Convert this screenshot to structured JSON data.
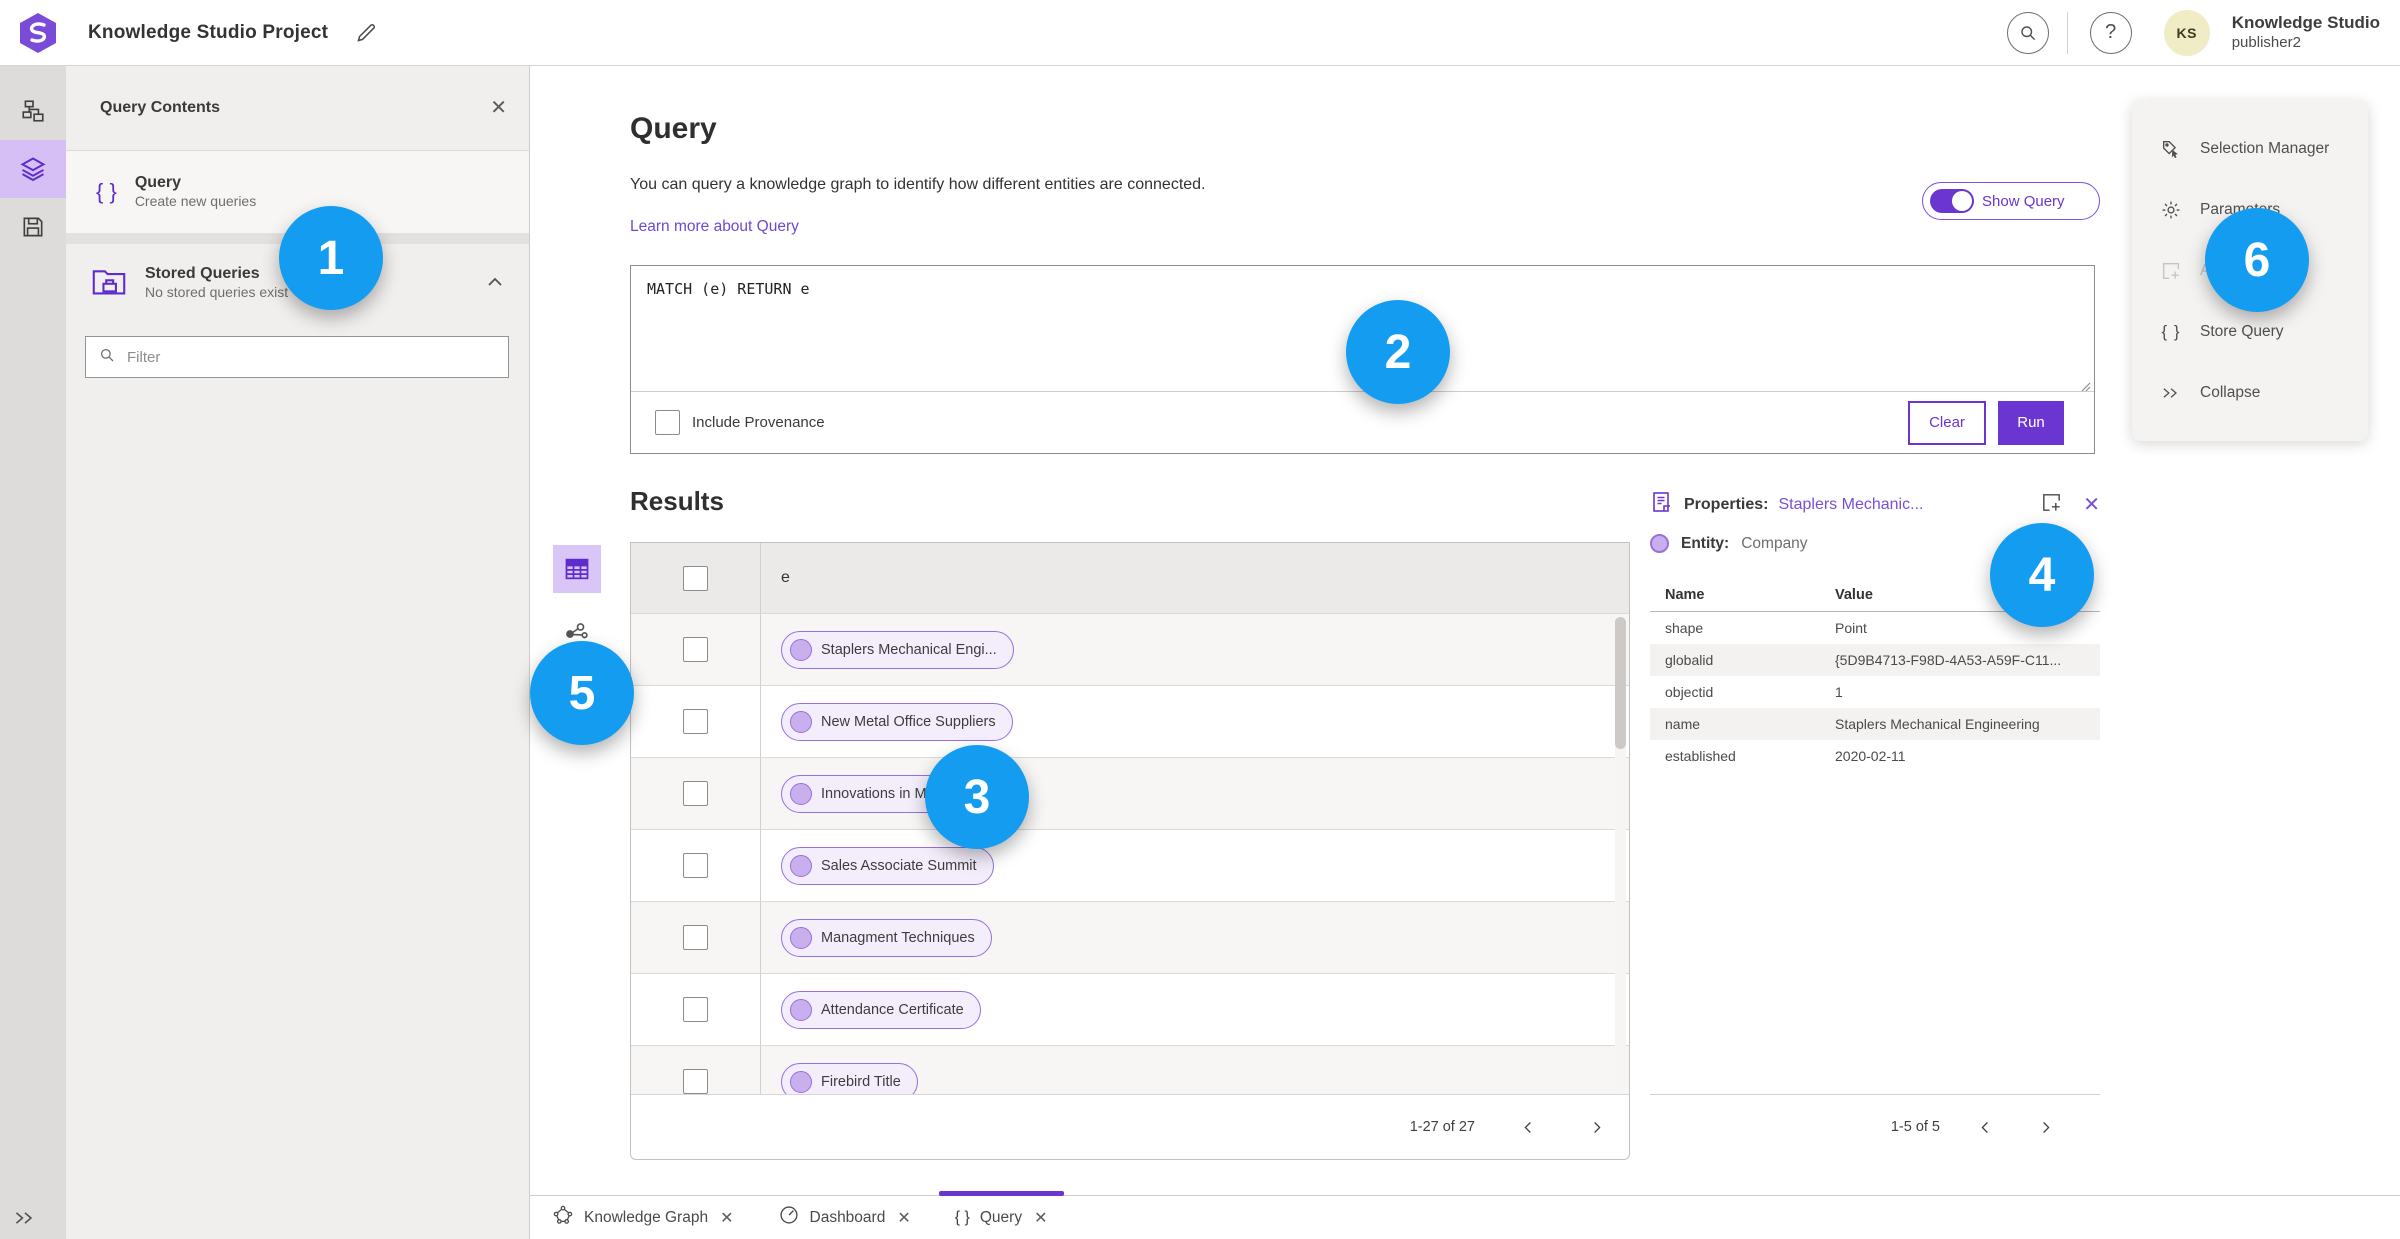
{
  "header": {
    "title": "Knowledge Studio Project",
    "user_name": "Knowledge Studio",
    "user_role": "publisher2",
    "avatar_initials": "KS",
    "help_glyph": "?"
  },
  "left_panel": {
    "title": "Query Contents",
    "close_glyph": "✕",
    "query_item": {
      "label": "Query",
      "sublabel": "Create new queries",
      "icon_glyph": "{ }"
    },
    "stored_item": {
      "label": "Stored Queries",
      "sublabel": "No stored queries exist"
    },
    "filter_placeholder": "Filter"
  },
  "query_section": {
    "heading": "Query",
    "description": "You can query a knowledge graph to identify how different entities are connected.",
    "link": "Learn more about Query",
    "show_query_label": "Show Query",
    "query_text": "MATCH (e) RETURN e",
    "provenance_label": "Include Provenance",
    "clear_label": "Clear",
    "run_label": "Run"
  },
  "results": {
    "heading": "Results",
    "column": "e",
    "rows": [
      "Staplers Mechanical Engi...",
      "New Metal Office Suppliers",
      "Innovations in Mechanical...",
      "Sales Associate Summit",
      "Managment Techniques",
      "Attendance Certificate",
      "Firebird Title"
    ],
    "pagination": "1-27 of 27"
  },
  "properties": {
    "label": "Properties:",
    "entity_link": "Staplers Mechanic...",
    "close_glyph": "✕",
    "entity_label": "Entity:",
    "entity_type": "Company",
    "columns": [
      "Name",
      "Value"
    ],
    "rows": [
      [
        "shape",
        "Point"
      ],
      [
        "globalid",
        "{5D9B4713-F98D-4A53-A59F-C11..."
      ],
      [
        "objectid",
        "1"
      ],
      [
        "name",
        "Staplers Mechanical Engineering"
      ],
      [
        "established",
        "2020-02-11"
      ]
    ],
    "pagination": "1-5 of 5"
  },
  "right_menu": {
    "items": [
      "Selection Manager",
      "Parameters",
      "Add",
      "Store Query",
      "Collapse"
    ],
    "store_query_glyph": "{ }"
  },
  "tabs": [
    {
      "label": "Knowledge Graph",
      "close_glyph": "✕"
    },
    {
      "label": "Dashboard",
      "close_glyph": "✕"
    },
    {
      "label": "Query",
      "close_glyph": "✕",
      "icon_glyph": "{ }"
    }
  ],
  "annotations": [
    "1",
    "2",
    "3",
    "4",
    "5",
    "6"
  ],
  "icons": {
    "search": "magnifier",
    "help": "question-circle",
    "edit": "pencil",
    "sidebar": [
      "hierarchy",
      "layers",
      "save"
    ],
    "expand": "double-chevron-right",
    "view_modes": [
      "table-grid",
      "link-analysis"
    ],
    "properties_header": [
      "page-document",
      "add-to-selection",
      "close-x"
    ],
    "pager": [
      "chevron-left",
      "chevron-right"
    ],
    "right_menu": [
      "selection-tag-cursor",
      "gear",
      "square-plus",
      "curly-braces",
      "double-chevron-right"
    ],
    "tab_icons": [
      "network-graph",
      "gauge",
      "curly-braces"
    ]
  },
  "colors": {
    "primary_purple": "#6a35d0",
    "icon_purple": "#5e2ccc",
    "annotation_blue": "#149df0",
    "pill_border": "#9671db",
    "pill_bg": "#f4eefc",
    "panel_gray": "#f1efee"
  }
}
